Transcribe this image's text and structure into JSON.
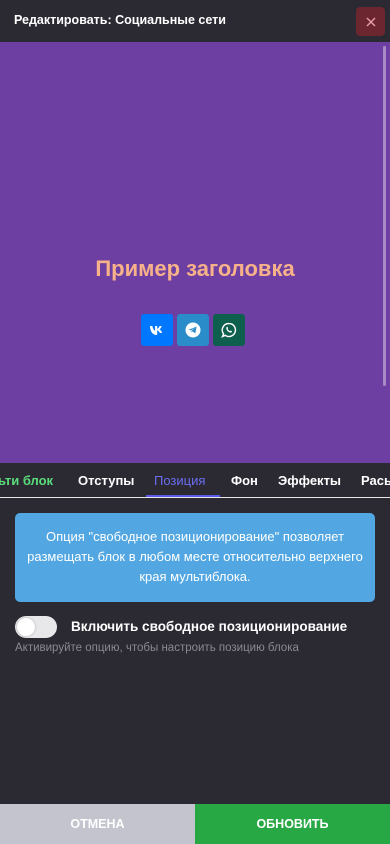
{
  "header": {
    "title": "Редактировать: Социальные сети"
  },
  "preview": {
    "heading": "Пример заголовка",
    "socials": [
      {
        "icon": "vk-icon",
        "color": "#0077ff"
      },
      {
        "icon": "telegram-icon",
        "color": "#2a8cc8"
      },
      {
        "icon": "whatsapp-icon",
        "color": "#0f5f4f"
      }
    ],
    "background": "#6e3fa3",
    "heading_color": "#f7b28a"
  },
  "tabs": [
    {
      "label": "Мульти блок",
      "visible_text": "ьти блок",
      "active": false
    },
    {
      "label": "Отступы",
      "active": false
    },
    {
      "label": "Позиция",
      "active": true
    },
    {
      "label": "Фон",
      "active": false
    },
    {
      "label": "Эффекты",
      "active": false
    },
    {
      "label": "Расширенные",
      "visible_text": "Рась",
      "active": false
    }
  ],
  "info": {
    "text": "Опция \"свободное позиционирование\" позволяет размещать блок в любом месте относительно верхнего края мультиблока."
  },
  "toggle": {
    "label": "Включить свободное позиционирование",
    "on": false,
    "hint": "Активируйте опцию, чтобы настроить позицию блока"
  },
  "buttons": {
    "cancel": "ОТМЕНА",
    "update": "ОБНОВИТЬ"
  },
  "colors": {
    "accent": "#5c5ce8",
    "info": "#52a7e3",
    "update": "#28a745",
    "cancel": "#c3c4cd",
    "close": "#6b2630"
  }
}
